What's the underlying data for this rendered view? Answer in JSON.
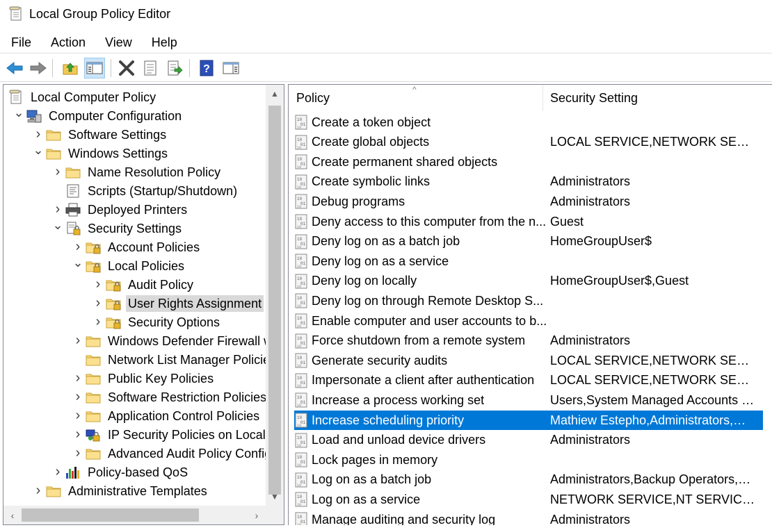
{
  "window": {
    "title": "Local Group Policy Editor",
    "icon": "gpedit-icon"
  },
  "menu": [
    "File",
    "Action",
    "View",
    "Help"
  ],
  "toolbar": [
    "back-arrow-icon",
    "forward-arrow-icon",
    "up-folder-icon",
    "show-hide-console-tree-icon",
    "delete-icon",
    "properties-icon",
    "export-list-icon",
    "help-icon",
    "show-hide-action-pane-icon"
  ],
  "tree": [
    {
      "label": "Local Computer Policy",
      "icon": "policy-doc-icon",
      "expand": "none",
      "level": 0
    },
    {
      "label": "Computer Configuration",
      "icon": "computer-icon",
      "expand": "open",
      "level": 1
    },
    {
      "label": "Software Settings",
      "icon": "folder-icon",
      "expand": "closed",
      "level": 2
    },
    {
      "label": "Windows Settings",
      "icon": "folder-icon",
      "expand": "open",
      "level": 2
    },
    {
      "label": "Name Resolution Policy",
      "icon": "folder-icon",
      "expand": "closed",
      "level": 3
    },
    {
      "label": "Scripts (Startup/Shutdown)",
      "icon": "script-icon",
      "expand": "none",
      "level": 3
    },
    {
      "label": "Deployed Printers",
      "icon": "printer-icon",
      "expand": "closed",
      "level": 3
    },
    {
      "label": "Security Settings",
      "icon": "security-settings-icon",
      "expand": "open",
      "level": 3
    },
    {
      "label": "Account Policies",
      "icon": "secure-folder-icon",
      "expand": "closed",
      "level": 4
    },
    {
      "label": "Local Policies",
      "icon": "secure-folder-icon",
      "expand": "open",
      "level": 4
    },
    {
      "label": "Audit Policy",
      "icon": "secure-folder-icon",
      "expand": "closed",
      "level": 5
    },
    {
      "label": "User Rights Assignment",
      "icon": "secure-folder-icon",
      "expand": "closed",
      "level": 5,
      "selected": true
    },
    {
      "label": "Security Options",
      "icon": "secure-folder-icon",
      "expand": "closed",
      "level": 5
    },
    {
      "label": "Windows Defender Firewall w",
      "icon": "folder-icon",
      "expand": "closed",
      "level": 4
    },
    {
      "label": "Network List Manager Policie",
      "icon": "folder-icon",
      "expand": "none",
      "level": 4
    },
    {
      "label": "Public Key Policies",
      "icon": "folder-icon",
      "expand": "closed",
      "level": 4
    },
    {
      "label": "Software Restriction Policies",
      "icon": "folder-icon",
      "expand": "closed",
      "level": 4
    },
    {
      "label": "Application Control Policies",
      "icon": "folder-icon",
      "expand": "closed",
      "level": 4
    },
    {
      "label": "IP Security Policies on Local C",
      "icon": "ip-security-icon",
      "expand": "closed",
      "level": 4
    },
    {
      "label": "Advanced Audit Policy Config",
      "icon": "folder-icon",
      "expand": "closed",
      "level": 4
    },
    {
      "label": "Policy-based QoS",
      "icon": "qos-chart-icon",
      "expand": "closed",
      "level": 3
    },
    {
      "label": "Administrative Templates",
      "icon": "folder-icon",
      "expand": "closed",
      "level": 2
    }
  ],
  "list": {
    "columns": [
      "Policy",
      "Security Setting"
    ],
    "rows": [
      {
        "policy": "Create a token object",
        "setting": ""
      },
      {
        "policy": "Create global objects",
        "setting": "LOCAL SERVICE,NETWORK SERVICE,A..."
      },
      {
        "policy": "Create permanent shared objects",
        "setting": ""
      },
      {
        "policy": "Create symbolic links",
        "setting": "Administrators"
      },
      {
        "policy": "Debug programs",
        "setting": "Administrators"
      },
      {
        "policy": "Deny access to this computer from the n...",
        "setting": "Guest"
      },
      {
        "policy": "Deny log on as a batch job",
        "setting": "HomeGroupUser$"
      },
      {
        "policy": "Deny log on as a service",
        "setting": ""
      },
      {
        "policy": "Deny log on locally",
        "setting": "HomeGroupUser$,Guest"
      },
      {
        "policy": "Deny log on through Remote Desktop S...",
        "setting": ""
      },
      {
        "policy": "Enable computer and user accounts to b...",
        "setting": ""
      },
      {
        "policy": "Force shutdown from a remote system",
        "setting": "Administrators"
      },
      {
        "policy": "Generate security audits",
        "setting": "LOCAL SERVICE,NETWORK SERVICE"
      },
      {
        "policy": "Impersonate a client after authentication",
        "setting": "LOCAL SERVICE,NETWORK SERVICE,A..."
      },
      {
        "policy": "Increase a process working set",
        "setting": "Users,System Managed Accounts Gr..."
      },
      {
        "policy": "Increase scheduling priority",
        "setting": "Mathiew Estepho,Administrators,Wi...",
        "selected": true
      },
      {
        "policy": "Load and unload device drivers",
        "setting": "Administrators"
      },
      {
        "policy": "Lock pages in memory",
        "setting": ""
      },
      {
        "policy": "Log on as a batch job",
        "setting": "Administrators,Backup Operators,Per..."
      },
      {
        "policy": "Log on as a service",
        "setting": "NETWORK SERVICE,NT SERVICE\\ALL ..."
      },
      {
        "policy": "Manage auditing and security log",
        "setting": "Administrators"
      }
    ]
  },
  "colors": {
    "selection": "#0078d7",
    "tree_selection": "#d9d9d9",
    "folder": "#f8d775",
    "border": "#828790"
  }
}
